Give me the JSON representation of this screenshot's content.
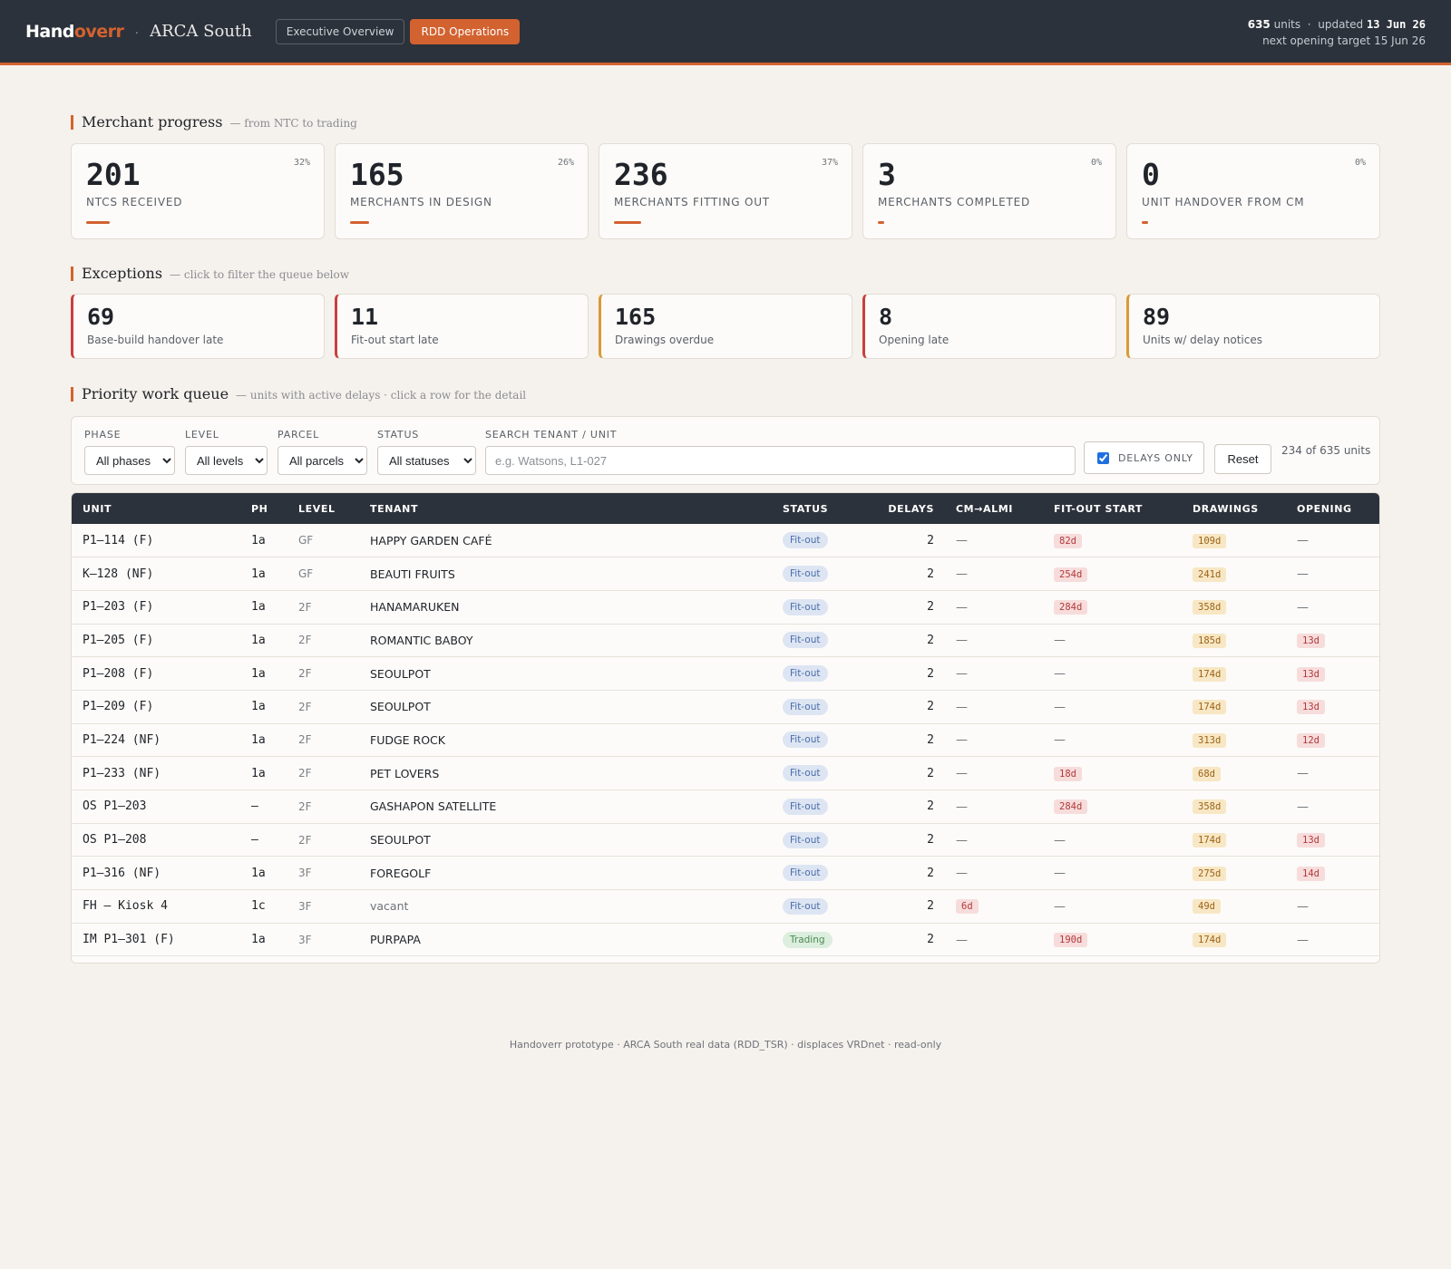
{
  "header": {
    "brand_part1": "Hand",
    "brand_part2": "overr",
    "separator": "·",
    "site_name": "ARCA South",
    "tabs": [
      {
        "label": "Executive Overview",
        "active": false
      },
      {
        "label": "RDD Operations",
        "active": true
      }
    ],
    "units_count": "635",
    "units_label": "units",
    "updated_label": "updated",
    "updated_date": "13 Jun 26",
    "next_opening": "next opening target 15 Jun 26"
  },
  "merchant_progress": {
    "title": "Merchant progress",
    "subtitle": "— from NTC to trading",
    "cards": [
      {
        "value": "201",
        "percent": "32%",
        "label": "NTCS RECEIVED",
        "fill": 0.32
      },
      {
        "value": "165",
        "percent": "26%",
        "label": "MERCHANTS IN DESIGN",
        "fill": 0.26
      },
      {
        "value": "236",
        "percent": "37%",
        "label": "MERCHANTS FITTING OUT",
        "fill": 0.37
      },
      {
        "value": "3",
        "percent": "0%",
        "label": "MERCHANTS COMPLETED",
        "fill": 0.0
      },
      {
        "value": "0",
        "percent": "0%",
        "label": "UNIT HANDOVER FROM CM",
        "fill": 0.0
      }
    ]
  },
  "exceptions": {
    "title": "Exceptions",
    "subtitle": "— click to filter the queue below",
    "cards": [
      {
        "value": "69",
        "label": "Base-build handover late",
        "color": "#c8403e"
      },
      {
        "value": "11",
        "label": "Fit-out start late",
        "color": "#c8403e"
      },
      {
        "value": "165",
        "label": "Drawings overdue",
        "color": "#d99a35"
      },
      {
        "value": "8",
        "label": "Opening late",
        "color": "#c8403e"
      },
      {
        "value": "89",
        "label": "Units w/ delay notices",
        "color": "#d99a35"
      }
    ]
  },
  "queue": {
    "title": "Priority work queue",
    "subtitle": "— units with active delays · click a row for the detail",
    "filters": {
      "phase_label": "PHASE",
      "phase_value": "All phases",
      "level_label": "LEVEL",
      "level_value": "All levels",
      "parcel_label": "PARCEL",
      "parcel_value": "All parcels",
      "status_label": "STATUS",
      "status_value": "All statuses",
      "search_label": "SEARCH TENANT / UNIT",
      "search_placeholder": "e.g. Watsons, L1-027",
      "search_value": "",
      "delays_only_label": "DELAYS ONLY",
      "delays_only_checked": true,
      "reset_label": "Reset",
      "count_text": "234 of 635 units"
    },
    "columns": [
      "UNIT",
      "PH",
      "LEVEL",
      "TENANT",
      "STATUS",
      "DELAYS",
      "CM→ALMI",
      "FIT-OUT START",
      "DRAWINGS",
      "OPENING"
    ],
    "rows": [
      {
        "unit": "P1–114 (F)",
        "ph": "1a",
        "level": "GF",
        "tenant": "HAPPY GARDEN CAFÉ",
        "status": "Fit-out",
        "delays": "2",
        "cm": "—",
        "fitout": "82d",
        "drawings": "109d",
        "opening": "—"
      },
      {
        "unit": "K–128 (NF)",
        "ph": "1a",
        "level": "GF",
        "tenant": "BEAUTI FRUITS",
        "status": "Fit-out",
        "delays": "2",
        "cm": "—",
        "fitout": "254d",
        "drawings": "241d",
        "opening": "—"
      },
      {
        "unit": "P1–203 (F)",
        "ph": "1a",
        "level": "2F",
        "tenant": "HANAMARUKEN",
        "status": "Fit-out",
        "delays": "2",
        "cm": "—",
        "fitout": "284d",
        "drawings": "358d",
        "opening": "—"
      },
      {
        "unit": "P1–205 (F)",
        "ph": "1a",
        "level": "2F",
        "tenant": "ROMANTIC BABOY",
        "status": "Fit-out",
        "delays": "2",
        "cm": "—",
        "fitout": "—",
        "drawings": "185d",
        "opening": "13d"
      },
      {
        "unit": "P1–208 (F)",
        "ph": "1a",
        "level": "2F",
        "tenant": "SEOULPOT",
        "status": "Fit-out",
        "delays": "2",
        "cm": "—",
        "fitout": "—",
        "drawings": "174d",
        "opening": "13d"
      },
      {
        "unit": "P1–209 (F)",
        "ph": "1a",
        "level": "2F",
        "tenant": "SEOULPOT",
        "status": "Fit-out",
        "delays": "2",
        "cm": "—",
        "fitout": "—",
        "drawings": "174d",
        "opening": "13d"
      },
      {
        "unit": "P1–224 (NF)",
        "ph": "1a",
        "level": "2F",
        "tenant": "FUDGE ROCK",
        "status": "Fit-out",
        "delays": "2",
        "cm": "—",
        "fitout": "—",
        "drawings": "313d",
        "opening": "12d"
      },
      {
        "unit": "P1–233 (NF)",
        "ph": "1a",
        "level": "2F",
        "tenant": "PET LOVERS",
        "status": "Fit-out",
        "delays": "2",
        "cm": "—",
        "fitout": "18d",
        "drawings": "68d",
        "opening": "—"
      },
      {
        "unit": "OS P1–203",
        "ph": "–",
        "level": "2F",
        "tenant": "GASHAPON SATELLITE",
        "status": "Fit-out",
        "delays": "2",
        "cm": "—",
        "fitout": "284d",
        "drawings": "358d",
        "opening": "—"
      },
      {
        "unit": "OS P1–208",
        "ph": "–",
        "level": "2F",
        "tenant": "SEOULPOT",
        "status": "Fit-out",
        "delays": "2",
        "cm": "—",
        "fitout": "—",
        "drawings": "174d",
        "opening": "13d"
      },
      {
        "unit": "P1–316 (NF)",
        "ph": "1a",
        "level": "3F",
        "tenant": "FOREGOLF",
        "status": "Fit-out",
        "delays": "2",
        "cm": "—",
        "fitout": "—",
        "drawings": "275d",
        "opening": "14d"
      },
      {
        "unit": "FH – Kiosk 4",
        "ph": "1c",
        "level": "3F",
        "tenant": "vacant",
        "status": "Fit-out",
        "delays": "2",
        "cm": "6d",
        "fitout": "—",
        "drawings": "49d",
        "opening": "—"
      },
      {
        "unit": "IM P1–301 (F)",
        "ph": "1a",
        "level": "3F",
        "tenant": "PURPAPA",
        "status": "Trading",
        "delays": "2",
        "cm": "—",
        "fitout": "190d",
        "drawings": "174d",
        "opening": "—"
      }
    ]
  },
  "footer": {
    "text": "Handoverr prototype · ARCA South real data (RDD_TSR) · displaces VRDnet · read-only"
  },
  "colors": {
    "accent": "#d2622f",
    "header_bg": "#2c323b",
    "late_red": "#c8403e",
    "overdue_amber": "#d99a35"
  }
}
